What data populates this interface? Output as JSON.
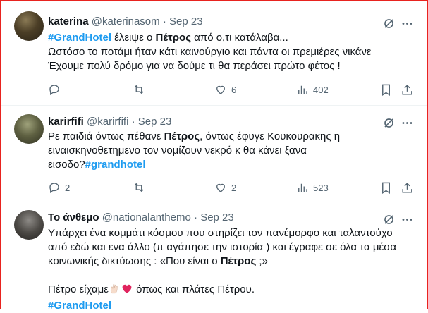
{
  "tweets": [
    {
      "name": "katerina",
      "handle": "@katerinasom",
      "dot": "·",
      "date": "Sep 23",
      "line1_hashtag": "#GrandHotel",
      "line1_a": " έλειψε ο ",
      "line1_bold": "Πέτρος",
      "line1_b": " από ο,τι κατάλαβα...",
      "line2": "Ωστόσο το ποτάμι ήταν κάτι καινούργιο και πάντα οι πρεμιέρες νικάνε",
      "line3": "Έχουμε πολύ δρόμο για να δούμε τι θα περάσει πρώτο φέτος !",
      "replies": "",
      "retweets": "",
      "likes": "6",
      "views": "402"
    },
    {
      "name": "karirfifi",
      "handle": "@karirfifi",
      "dot": "·",
      "date": "Sep 23",
      "line1_a": "Ρε παιδιά όντως πέθανε ",
      "line1_bold": "Πέτρος",
      "line1_b": ", όντως έφυγε Κουκουρακης η",
      "line2": "ειναισκηνοθετημενο τον νομίζουν νεκρό κ θα κάνει  ξανα",
      "line3_text": "εισοδο?",
      "line3_hashtag": "#grandhotel",
      "replies": "2",
      "retweets": "",
      "likes": "2",
      "views": "523"
    },
    {
      "name": "Το άνθεμο",
      "handle": "@nationalanthemo",
      "dot": "·",
      "date": "Sep 23",
      "line1": "Υπάρχει ένα κομμάτι κόσμου που στηρίζει τον πανέμορφο και ταλαντούχο",
      "line2": "από εδώ και ενα άλλο (π αγάπησε την ιστορία ) και έγραφε σε όλα τα μέσα",
      "line3_a": "κοινωνικής δικτύωσης : «Που είναι ο ",
      "line3_bold": "Πέτρος",
      "line3_b": " ;»",
      "line4_a": "Πέτρο είχαμε",
      "line4_b": " όπως και πλάτες Πέτρου.",
      "line5_hashtag": "#GrandHotel"
    }
  ],
  "colors": {
    "accent": "#1d9bf0",
    "frame": "#e8231f",
    "muted": "#536471"
  }
}
